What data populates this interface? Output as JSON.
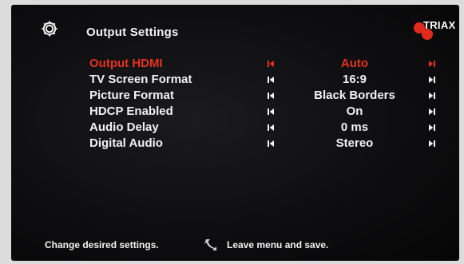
{
  "header": {
    "title": "Output Settings",
    "logo_text": "TRIAX",
    "gear_icon": "gear-icon"
  },
  "settings": [
    {
      "label": "Output HDMI",
      "value": "Auto",
      "selected": true
    },
    {
      "label": "TV Screen Format",
      "value": "16:9",
      "selected": false
    },
    {
      "label": "Picture Format",
      "value": "Black Borders",
      "selected": false
    },
    {
      "label": "HDCP Enabled",
      "value": "On",
      "selected": false
    },
    {
      "label": "Audio Delay",
      "value": "0 ms",
      "selected": false
    },
    {
      "label": "Digital Audio",
      "value": "Stereo",
      "selected": false
    }
  ],
  "footer": {
    "hint": "Change desired settings.",
    "back_icon": "back-arrow-icon",
    "save_hint": "Leave menu and save."
  },
  "colors": {
    "accent": "#e5311f",
    "text": "#f2f2f2",
    "background": "#0e0e10"
  }
}
